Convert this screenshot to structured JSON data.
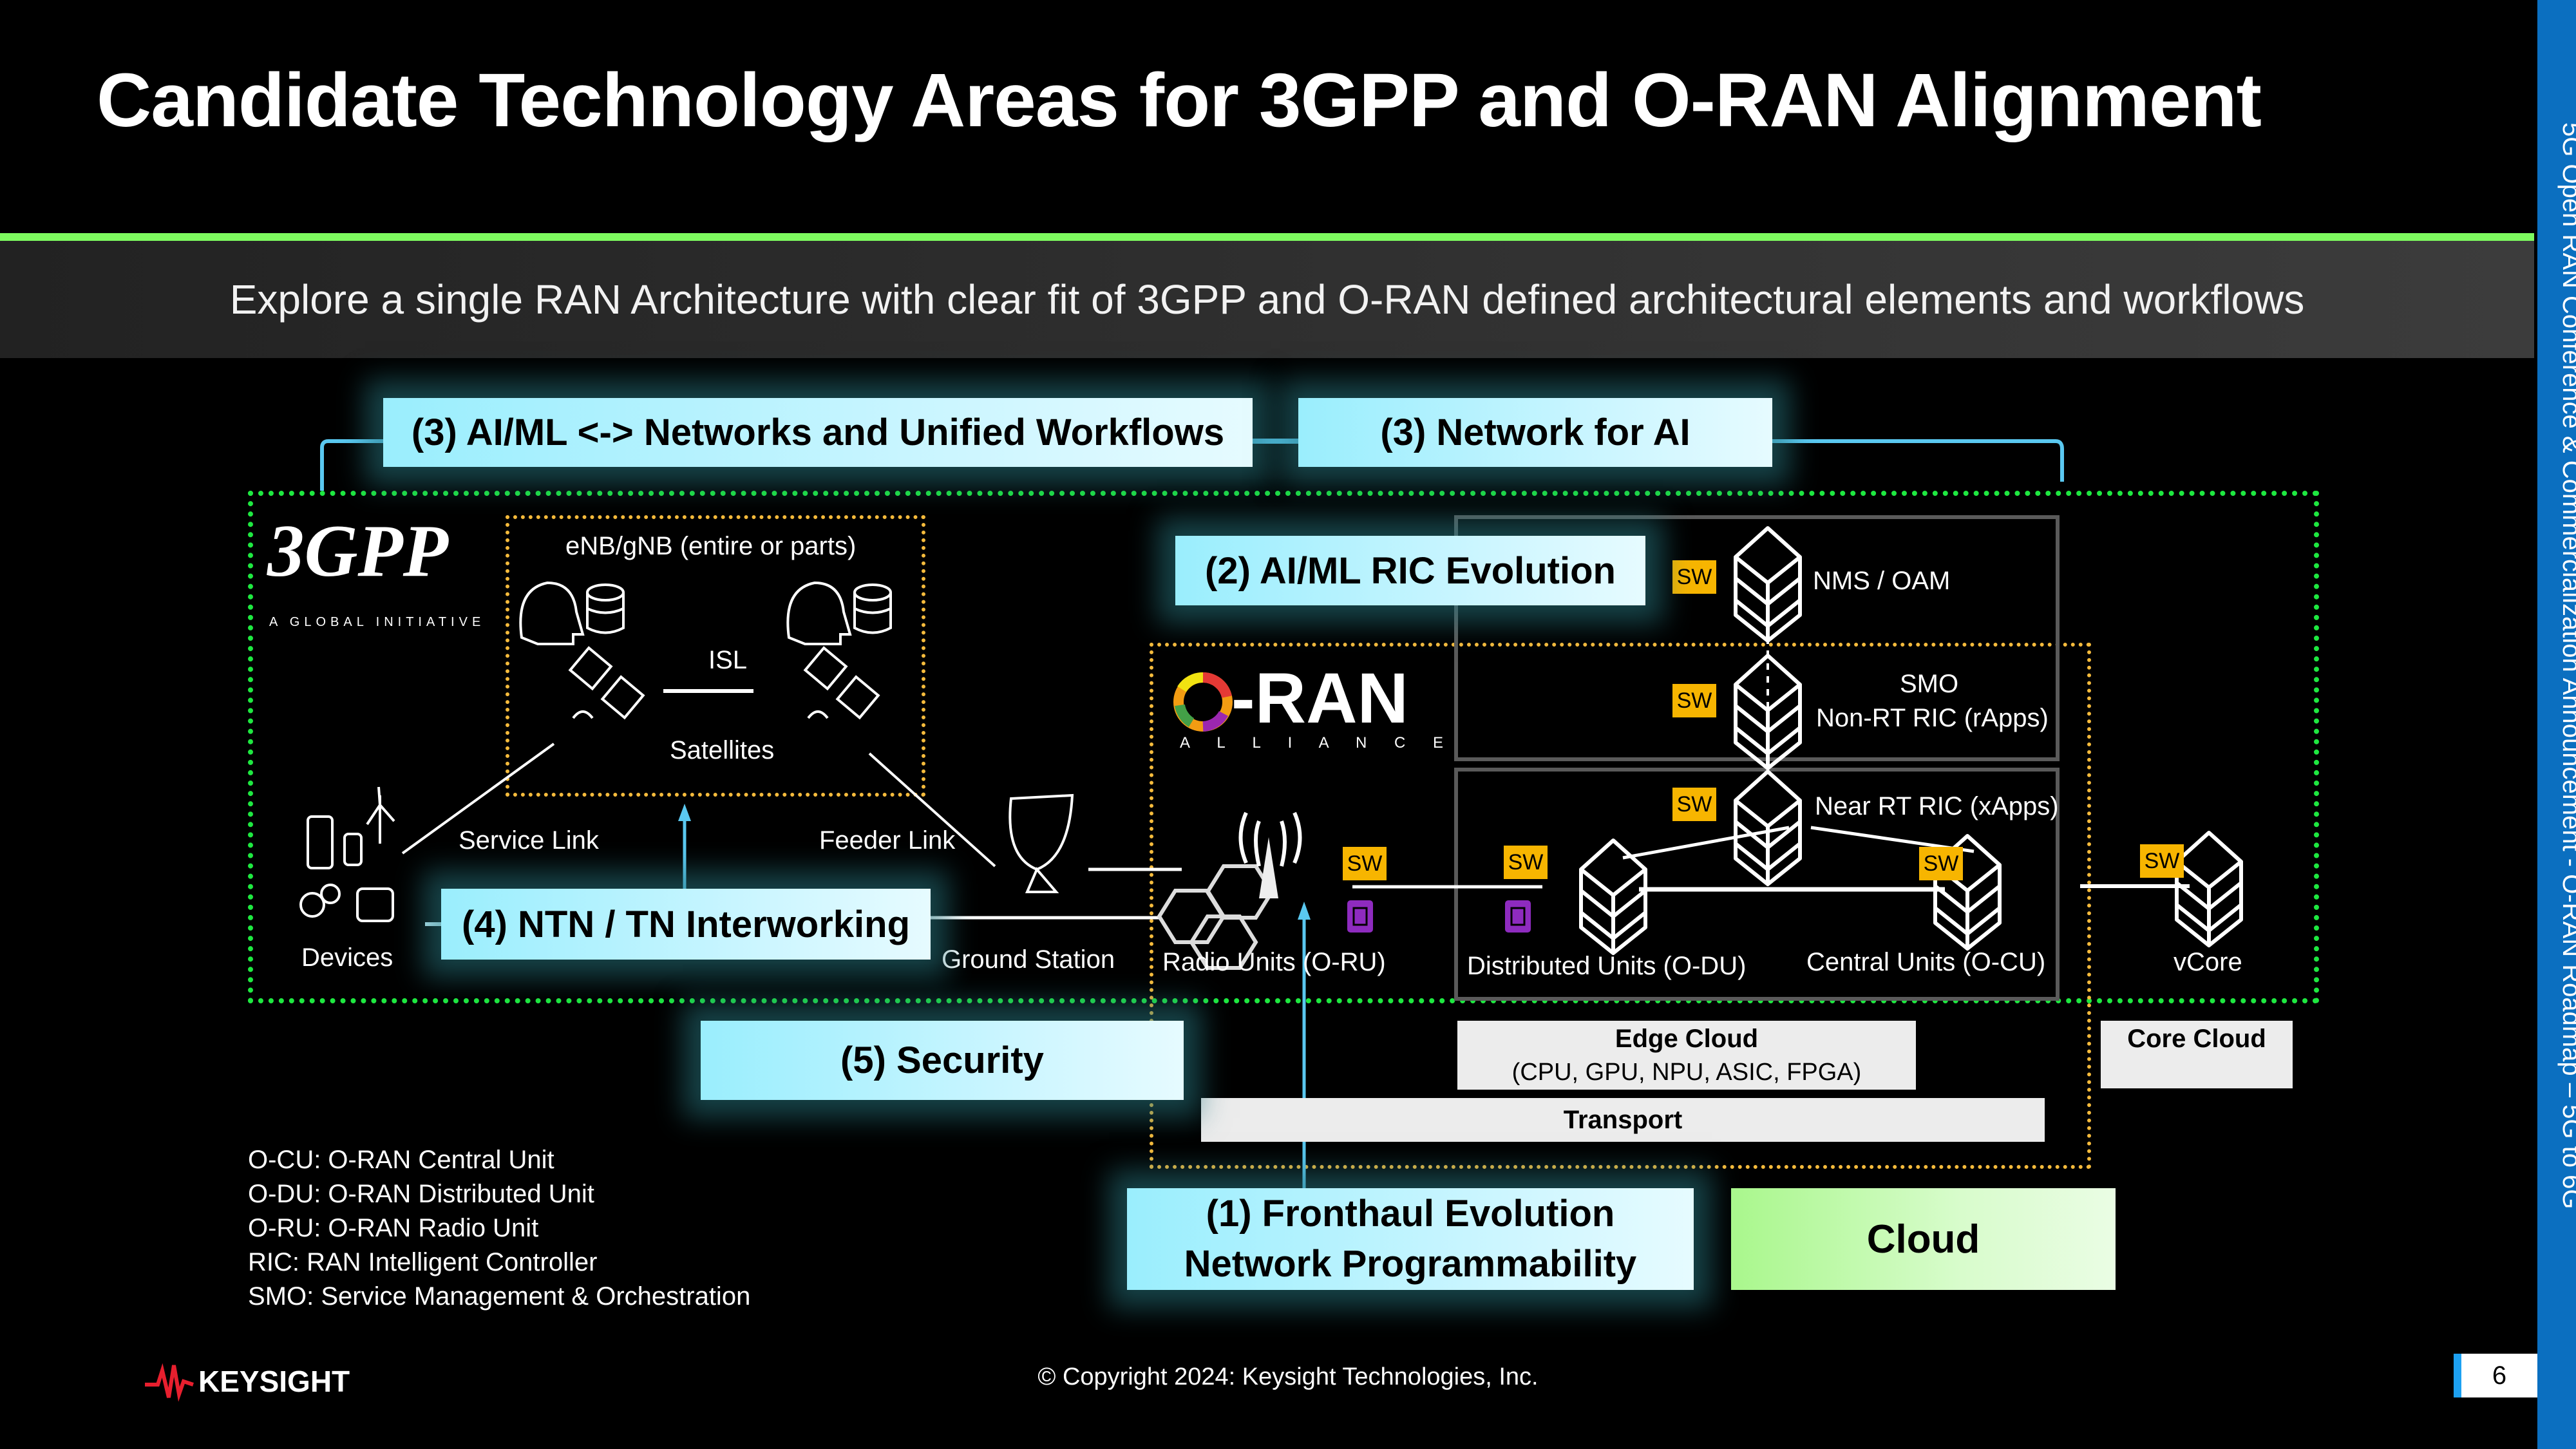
{
  "slide": {
    "title": "Candidate Technology Areas for 3GPP and O-RAN Alignment",
    "subtitle": "Explore a single RAN Architecture with clear fit of 3GPP and O-RAN defined architectural elements and workflows",
    "sidebar_text": "5G Open RAN Conference & Commercialization Announcement - O-RAN Roadmap – 5G to 6G",
    "page_number": "6",
    "copyright": "© Copyright 2024: Keysight Technologies, Inc.",
    "brand": "KEYSIGHT"
  },
  "callouts": {
    "aiml_workflows": "(3) AI/ML <-> Networks and Unified Workflows",
    "network_for_ai": "(3) Network for AI",
    "ric_evolution": "(2) AI/ML RIC Evolution",
    "ntn_tn": "(4) NTN / TN Interworking",
    "security": "(5) Security",
    "fronthaul_line1": "(1) Fronthaul Evolution",
    "fronthaul_line2": "Network Programmability",
    "cloud": "Cloud"
  },
  "logos": {
    "gpp_main": "3GPP",
    "gpp_tag": "A GLOBAL INITIATIVE",
    "oran_main": "-RAN",
    "oran_tag": "A L L I A N C E"
  },
  "ntn": {
    "enb_gnb": "eNB/gNB (entire or parts)",
    "isl": "ISL",
    "satellites": "Satellites",
    "service_link": "Service Link",
    "feeder_link": "Feeder Link",
    "devices": "Devices",
    "ground_station": "Ground Station"
  },
  "oran": {
    "sw_label": "SW",
    "nms_oam": "NMS / OAM",
    "smo": "SMO",
    "non_rt_ric": "Non-RT RIC (rApps)",
    "near_rt_ric": "Near RT RIC (xApps)",
    "radio_units": "Radio Units (O-RU)",
    "distributed_units": "Distributed Units (O-DU)",
    "central_units": "Central Units (O-CU)",
    "vcore": "vCore"
  },
  "infra": {
    "edge_cloud": "Edge Cloud",
    "edge_cloud_sub": "(CPU, GPU, NPU, ASIC, FPGA)",
    "core_cloud": "Core Cloud",
    "transport": "Transport"
  },
  "glossary": [
    "O-CU: O-RAN Central Unit",
    "O-DU: O-RAN Distributed Unit",
    "O-RU: O-RAN Radio Unit",
    "RIC: RAN Intelligent Controller",
    "SMO: Service Management & Orchestration"
  ],
  "colors": {
    "accent_green": "#7dfa5f",
    "callout_cyan": "#9aeefd",
    "sw_badge": "#f7b500",
    "sidebar_blue": "#0b6fc0",
    "chip_purple": "#8e2bbf"
  }
}
